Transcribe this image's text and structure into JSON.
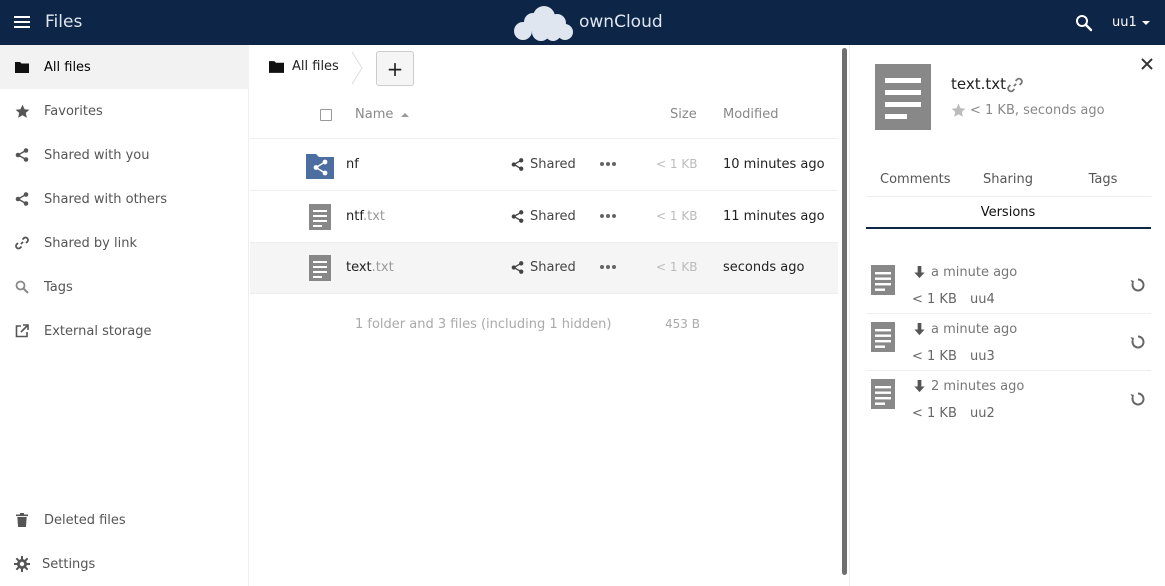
{
  "header": {
    "app_title": "Files",
    "brand": "ownCloud",
    "user": "uu1",
    "bg_color": "#0d2547"
  },
  "sidebar": {
    "items": [
      {
        "label": "All files",
        "icon": "folder-icon",
        "active": true
      },
      {
        "label": "Favorites",
        "icon": "star-icon"
      },
      {
        "label": "Shared with you",
        "icon": "share-icon"
      },
      {
        "label": "Shared with others",
        "icon": "share-icon"
      },
      {
        "label": "Shared by link",
        "icon": "link-icon"
      },
      {
        "label": "Tags",
        "icon": "search-icon"
      },
      {
        "label": "External storage",
        "icon": "external-icon"
      }
    ],
    "bottom": [
      {
        "label": "Deleted files",
        "icon": "trash-icon"
      },
      {
        "label": "Settings",
        "icon": "gear-icon"
      }
    ]
  },
  "breadcrumb": {
    "home_label": "All files",
    "new_label": "+"
  },
  "table": {
    "headers": {
      "name": "Name",
      "size": "Size",
      "modified": "Modified"
    },
    "rows": [
      {
        "name": "nf",
        "ext": "",
        "type": "shared-folder",
        "share_label": "Shared",
        "size": "< 1 KB",
        "modified": "10 minutes ago"
      },
      {
        "name": "ntf",
        "ext": ".txt",
        "type": "text-file",
        "share_label": "Shared",
        "size": "< 1 KB",
        "modified": "11 minutes ago"
      },
      {
        "name": "text",
        "ext": ".txt",
        "type": "text-file",
        "share_label": "Shared",
        "size": "< 1 KB",
        "modified": "seconds ago",
        "selected": true
      }
    ],
    "summary": "1 folder and 3 files (including 1 hidden)",
    "summary_size": "453 B"
  },
  "details": {
    "file_name": "text.txt",
    "meta": "< 1 KB, seconds ago",
    "tabs": [
      "Comments",
      "Sharing",
      "Tags",
      "Versions"
    ],
    "active_tab": "Versions",
    "versions": [
      {
        "time": "a minute ago",
        "size": "< 1 KB",
        "user": "uu4"
      },
      {
        "time": "a minute ago",
        "size": "< 1 KB",
        "user": "uu3"
      },
      {
        "time": "2 minutes ago",
        "size": "< 1 KB",
        "user": "uu2"
      }
    ]
  }
}
